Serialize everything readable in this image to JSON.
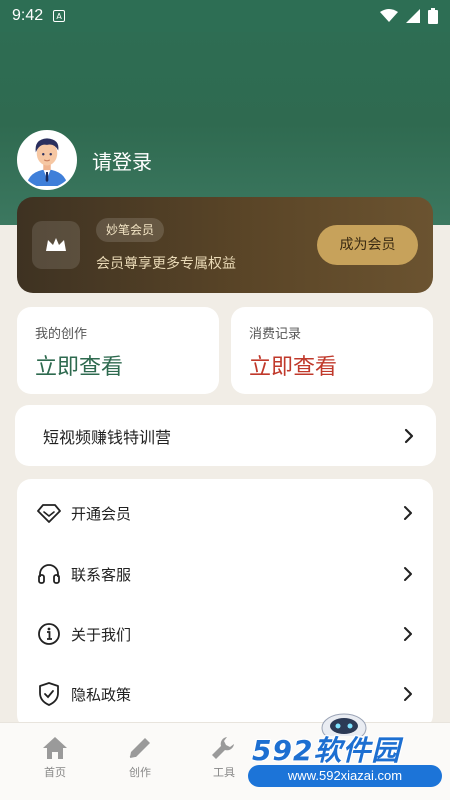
{
  "status_bar": {
    "time": "9:42",
    "notification_icon": "A"
  },
  "profile": {
    "login_text": "请登录",
    "avatar_icon": "user-avatar"
  },
  "vip": {
    "badge": "妙笔会员",
    "description": "会员尊享更多专属权益",
    "button": "成为会员",
    "icon": "crown-icon"
  },
  "stats": [
    {
      "label": "我的创作",
      "value": "立即查看"
    },
    {
      "label": "消费记录",
      "value": "立即查看"
    }
  ],
  "promo": {
    "text": "短视频赚钱特训营"
  },
  "menu": [
    {
      "label": "开通会员",
      "icon": "diamond-icon"
    },
    {
      "label": "联系客服",
      "icon": "headset-icon"
    },
    {
      "label": "关于我们",
      "icon": "info-icon"
    },
    {
      "label": "隐私政策",
      "icon": "shield-icon"
    }
  ],
  "bottom_nav": [
    {
      "label": "首页",
      "icon": "home-icon"
    },
    {
      "label": "创作",
      "icon": "pencil-icon"
    },
    {
      "label": "工具",
      "icon": "wrench-icon"
    }
  ],
  "watermark": {
    "main": "592软件园",
    "sub": "www.592xiazai.com"
  },
  "colors": {
    "header_green": "#2d6e54",
    "gold": "#c7a25b",
    "create_value": "#2e6a4f",
    "consume_value": "#c0392b"
  }
}
